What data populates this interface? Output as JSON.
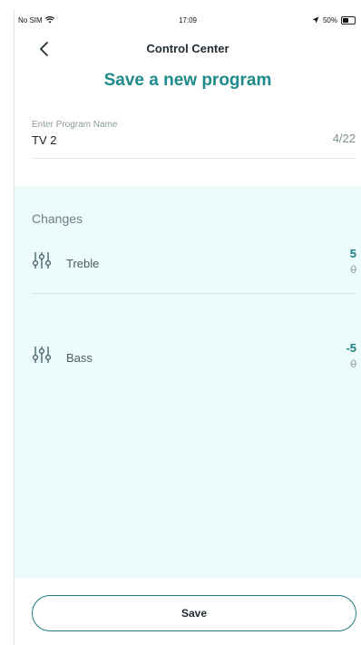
{
  "status_bar": {
    "carrier": "No SIM",
    "time": "17:09",
    "battery": "50%",
    "icons": [
      "wifi-icon",
      "location-arrow-icon",
      "battery-icon"
    ]
  },
  "nav": {
    "title": "Control Center",
    "back_icon": "chevron-left-icon"
  },
  "page": {
    "heading": "Save a new program"
  },
  "program_name": {
    "label": "Enter Program Name",
    "value": "TV 2",
    "counter": "4/22"
  },
  "changes": {
    "title": "Changes",
    "rows": [
      {
        "label": "Treble",
        "new_value": "5",
        "old_value": "0",
        "icon": "equalizer-sliders-icon"
      },
      {
        "label": "Bass",
        "new_value": "-5",
        "old_value": "0",
        "icon": "equalizer-sliders-icon"
      }
    ]
  },
  "footer": {
    "save_label": "Save"
  },
  "colors": {
    "accent": "#1f8a8a",
    "panel_background": "#ecfbfc",
    "button_border": "#1d7a7d"
  }
}
